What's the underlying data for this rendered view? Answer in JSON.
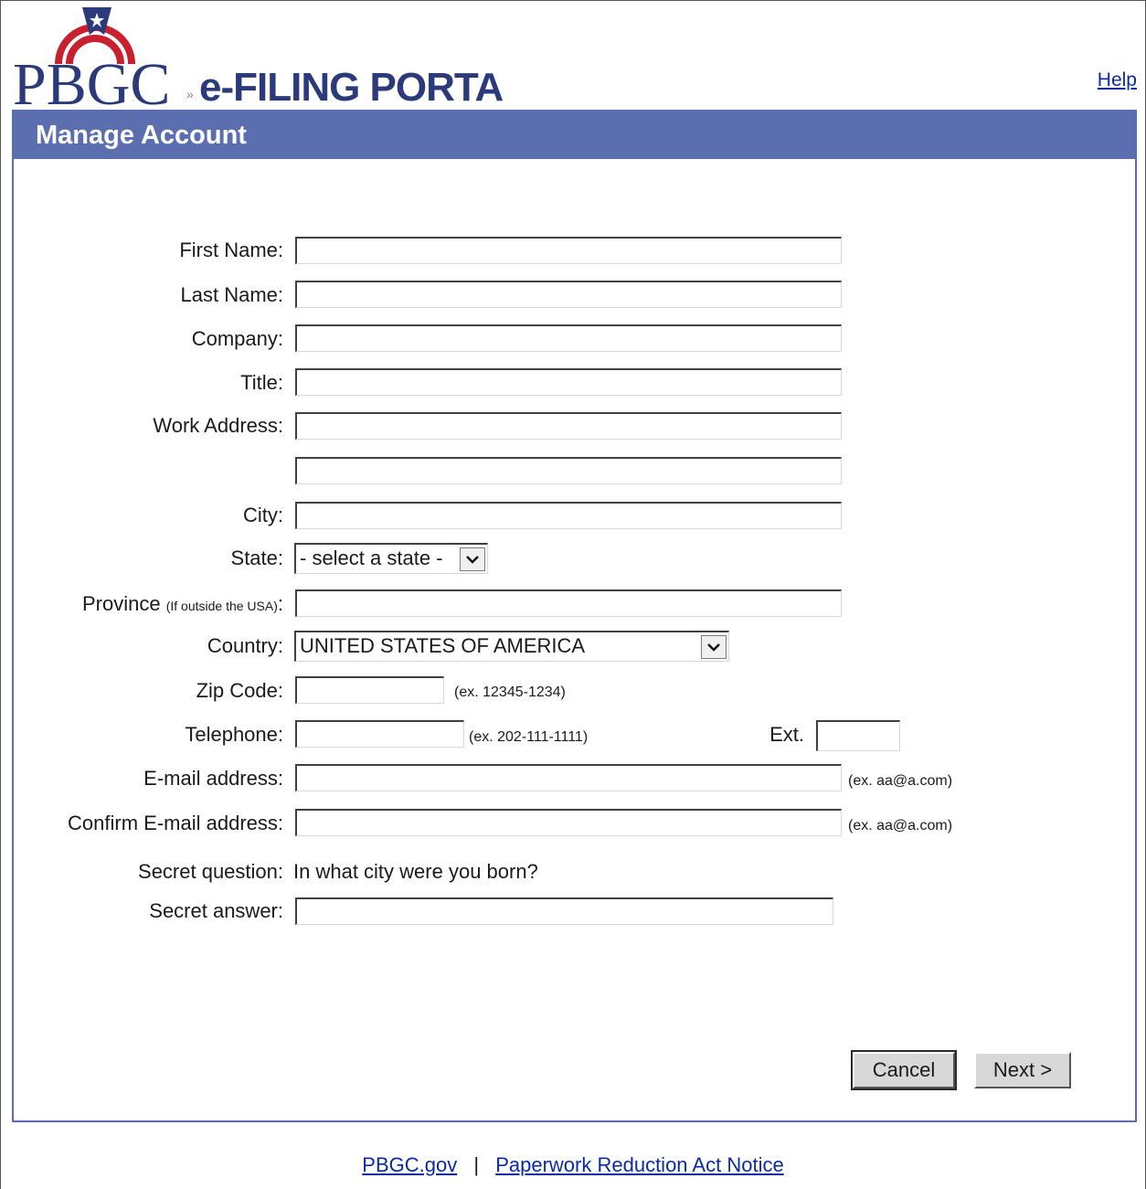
{
  "header": {
    "logo_text": "PBGC",
    "portal_name": "e-FILING PORTAL",
    "help_link": "Help"
  },
  "panel": {
    "title": "Manage Account"
  },
  "form": {
    "first_name": {
      "label": "First Name:",
      "value": ""
    },
    "last_name": {
      "label": "Last Name:",
      "value": ""
    },
    "company": {
      "label": "Company:",
      "value": ""
    },
    "title": {
      "label": "Title:",
      "value": ""
    },
    "work_address": {
      "label": "Work Address:",
      "value1": "",
      "value2": ""
    },
    "city": {
      "label": "City:",
      "value": ""
    },
    "state": {
      "label": "State:",
      "selected": "- select a state -"
    },
    "province": {
      "label": "Province",
      "note": "(If outside the USA)",
      "colon": ":",
      "value": ""
    },
    "country": {
      "label": "Country:",
      "selected": "UNITED STATES OF AMERICA"
    },
    "zip": {
      "label": "Zip Code:",
      "hint": "(ex. 12345-1234)",
      "value": ""
    },
    "telephone": {
      "label": "Telephone:",
      "hint": "(ex. 202-111-1111)",
      "ext_label": "Ext.",
      "value": ""
    },
    "email": {
      "label": "E-mail address:",
      "hint": "(ex. aa@a.com)",
      "value": ""
    },
    "confirm_email": {
      "label": "Confirm E-mail address:",
      "hint": "(ex. aa@a.com)",
      "value": ""
    },
    "secret_question": {
      "label": "Secret question:",
      "value": "In what city were you born?"
    },
    "secret_answer": {
      "label": "Secret answer:",
      "value": ""
    }
  },
  "buttons": {
    "cancel": "Cancel",
    "next": "Next >"
  },
  "footer": {
    "link1": "PBGC.gov",
    "separator": "|",
    "link2": "Paperwork Reduction Act Notice"
  },
  "colors": {
    "panel_blue": "#5b6eaf",
    "logo_red": "#c8202f",
    "logo_navy": "#2b3a7a",
    "link_blue": "#0a2aa6"
  }
}
